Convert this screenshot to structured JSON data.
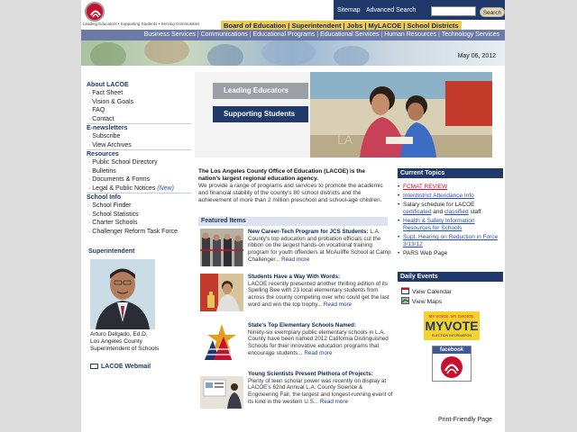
{
  "header": {
    "tagline": "Leading Educators • Supporting Students • Serving Communities",
    "top_links": [
      "Board of Education",
      "Superintendent",
      "Jobs",
      "MyLACOE",
      "School Districts"
    ],
    "utility": {
      "sitemap": "Sitemap",
      "advanced_search": "Advanced Search",
      "search_placeholder": "",
      "search_button": "Search"
    }
  },
  "nav": {
    "items": [
      "Business Services",
      "Communications",
      "Educational Programs",
      "Educational Services",
      "Human Resources",
      "Technology Services"
    ]
  },
  "banner": {
    "date": "May 06, 2012"
  },
  "leftnav": {
    "sections": [
      {
        "title": "About LACOE",
        "items": [
          "Fact Sheet",
          "Vision & Goals",
          "FAQ",
          "Contact"
        ]
      },
      {
        "title": "E-newsletters",
        "items": [
          "Subscribe",
          "View Archives"
        ]
      },
      {
        "title": "Resources",
        "items": [
          "Public School Directory",
          "Bulletins",
          "Documents & Forms",
          "Legal & Public Notices"
        ],
        "new_label": "(New)"
      },
      {
        "title": "School Info",
        "items": [
          "School Finder",
          "School Statistics",
          "Charter Schools",
          "Challenger Reform Task Force"
        ]
      }
    ],
    "superintendent_heading": "Superintendent",
    "superintendent_name": "Arturo Delgado, Ed.D.",
    "superintendent_role_1": "Los Angeles County",
    "superintendent_role_2": "Superintendent of Schools",
    "webmail": "LACOE Webmail"
  },
  "hero": {
    "btn_1": "Leading Educators",
    "btn_2": "Supporting Students"
  },
  "intro": {
    "bold": "The Los Angeles County Office of Education (LACOE) is the nation's largest regional education agency.",
    "text": "We provide a range of programs and services to promote the academic and financial stability of the county's 80 school districts and the achievement of more than 2 million preschool and school-age children."
  },
  "featured": {
    "heading": "Featured Items",
    "items": [
      {
        "title": "New Career-Tech Program for JCS Students:",
        "body": "L.A. County's top education and probation officials cut the ribbon on the largest hands-on vocational training program for youth offenders at McAuliffe School at Camp Challenger...",
        "more": "Read more"
      },
      {
        "title": "Students Have a Way With Words:",
        "body": "LACOE recently presented another thrilling edition of its Spelling Bee with 23 local elementary students from across the county competing over who could get the last word and win the top trophy...",
        "more": "Read more"
      },
      {
        "title": "State's Top Elementary Schools Named:",
        "body": "Ninety-six exemplary public elementary schools in L.A. County have been named 2012 California Distinguished Schools for their innovative education programs that encourage students...",
        "more": "Read more"
      },
      {
        "title": "Young Scientists Present Plethora of Projects:",
        "body": "Plenty of teen scholar power was recently on display at LACOE's 62nd Annual L.A. County Science & Engineering Fair, the largest and longest-running event of its kind in the western U.S...",
        "more": "Read more"
      }
    ]
  },
  "current_topics": {
    "heading": "Current Topics",
    "items": [
      {
        "text": "FCMAT REVIEW",
        "style": "red"
      },
      {
        "text": "Interdistrict Attendance Info",
        "style": "link"
      },
      {
        "text_before": "Salary schedule for LACOE",
        "link_1": "certificated",
        "mid": "and",
        "link_2": "classified",
        "after": "staff",
        "style": "mixed"
      },
      {
        "text": "Health & Safety Information Resources for Schools",
        "style": "link"
      },
      {
        "text": "Supt. Hearing on Reduction in Force 3/13/12",
        "style": "link"
      },
      {
        "text": "PARS Web Page",
        "style": "plain"
      }
    ]
  },
  "daily_events": {
    "heading": "Daily Events",
    "view_calendar": "View Calendar",
    "view_maps": "View Maps"
  },
  "badges": {
    "myvote_top": "MY VOICE. MY CHOICE.",
    "myvote_main": "MYVOTE",
    "myvote_sub": "ELECTION INFORMATION",
    "facebook": "facebook"
  },
  "footer": {
    "print": "Print-Friendly Page"
  },
  "colors": {
    "navy": "#1f3a6a",
    "nav_purple": "#6b7aa6",
    "gold": "#f2c94c",
    "red": "#c8102e"
  }
}
